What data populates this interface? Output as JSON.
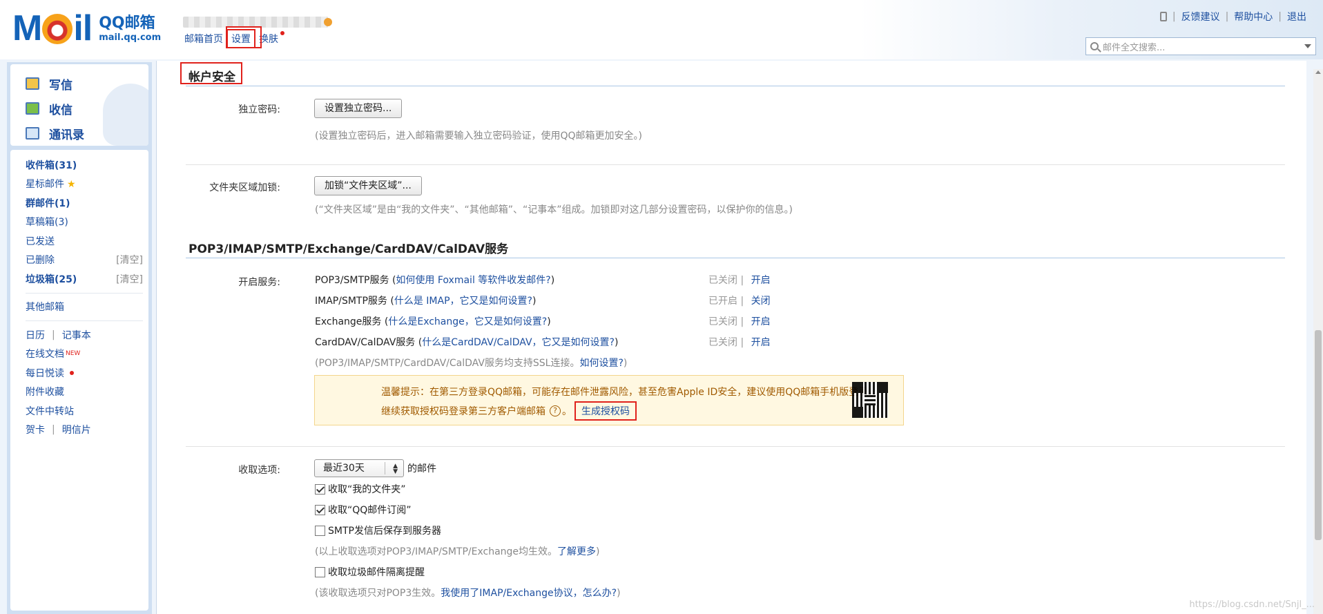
{
  "header": {
    "logo_mail": "MOil",
    "logo_brand": "QQ邮箱",
    "logo_domain": "mail.qq.com",
    "nav": [
      "邮箱首页",
      "设置",
      "换肤"
    ],
    "top_links": [
      "反馈建议",
      "帮助中心",
      "退出"
    ],
    "search_placeholder": "邮件全文搜索..."
  },
  "sidebar": {
    "quick": [
      "写信",
      "收信",
      "通讯录"
    ],
    "folders": [
      {
        "label": "收件箱(31)"
      },
      {
        "label": "星标邮件"
      },
      {
        "label": "群邮件(1)"
      },
      {
        "label": "草稿箱(3)"
      },
      {
        "label": "已发送"
      },
      {
        "label": "已删除",
        "action": "[清空]"
      },
      {
        "label": "垃圾箱(25)",
        "action": "[清空]"
      }
    ],
    "other_mailbox": "其他邮箱",
    "calendar": "日历",
    "notes": "记事本",
    "online_docs": "在线文档",
    "new_badge": "NEW",
    "daily_read": "每日悦读",
    "attachments": "附件收藏",
    "file_transfer": "文件中转站",
    "greeting_card": "贺卡",
    "postcard": "明信片"
  },
  "security": {
    "title": "帐户安全",
    "pw_label": "独立密码:",
    "pw_button": "设置独立密码...",
    "pw_note": "(设置独立密码后，进入邮箱需要输入独立密码验证，使用QQ邮箱更加安全。)",
    "lock_label": "文件夹区域加锁:",
    "lock_button": "加锁“文件夹区域”...",
    "lock_note": "(“文件夹区域”是由“我的文件夹”、“其他邮箱”、“记事本”组成。加锁即对这几部分设置密码，以保护你的信息。)"
  },
  "services": {
    "title": "POP3/IMAP/SMTP/Exchange/CardDAV/CalDAV服务",
    "label": "开启服务:",
    "items": [
      {
        "name": "POP3/SMTP服务",
        "link": "如何使用 Foxmail 等软件收发邮件?",
        "status": "已关闭",
        "action": "开启"
      },
      {
        "name": "IMAP/SMTP服务",
        "link": "什么是 IMAP，它又是如何设置?",
        "status": "已开启",
        "action": "关闭"
      },
      {
        "name": "Exchange服务",
        "link": "什么是Exchange，它又是如何设置?",
        "status": "已关闭",
        "action": "开启"
      },
      {
        "name": "CardDAV/CalDAV服务",
        "link": "什么是CardDAV/CalDAV，它又是如何设置?",
        "status": "已关闭",
        "action": "开启"
      }
    ],
    "ssl_note": "(POP3/IMAP/SMTP/CardDAV/CalDAV服务均支持SSL连接。",
    "ssl_link": "如何设置?",
    "tip_line1": "温馨提示：在第三方登录QQ邮箱，可能存在邮件泄露风险，甚至危害Apple ID安全，建议使用QQ邮箱手机版登录。",
    "tip_line2": "继续获取授权码登录第三方客户端邮箱",
    "gen_code": "生成授权码"
  },
  "fetch": {
    "label": "收取选项:",
    "period": "最近30天",
    "suffix": "的邮件",
    "options": [
      {
        "label": "收取“我的文件夹”",
        "checked": true
      },
      {
        "label": "收取“QQ邮件订阅”",
        "checked": true
      },
      {
        "label": "SMTP发信后保存到服务器",
        "checked": false
      }
    ],
    "note1": "(以上收取选项对POP3/IMAP/SMTP/Exchange均生效。",
    "note1_link": "了解更多",
    "spam_label": "收取垃圾邮件隔离提醒",
    "spam_checked": false,
    "note2": "(该收取选项只对POP3生效。",
    "note2_link": "我使用了IMAP/Exchange协议，怎么办?"
  },
  "watermark": "https://blog.csdn.net/Snjl_..."
}
